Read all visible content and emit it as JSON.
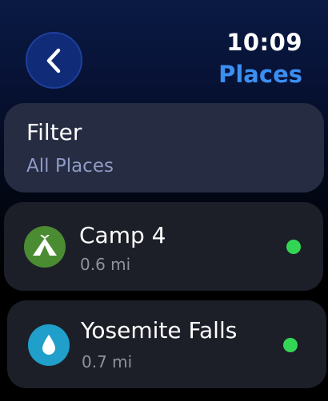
{
  "header": {
    "time": "10:09",
    "title": "Places",
    "back_icon": "chevron-left-icon"
  },
  "filter": {
    "label": "Filter",
    "value": "All Places"
  },
  "places": [
    {
      "name": "Camp 4",
      "distance": "0.6 mi",
      "icon": "campsite-tent-icon",
      "icon_color": "#4b8c33",
      "status_color": "#33d654"
    },
    {
      "name": "Yosemite Falls",
      "distance": "0.7 mi",
      "icon": "water-drop-icon",
      "icon_color": "#1f9fc9",
      "status_color": "#33d654"
    }
  ],
  "colors": {
    "accent": "#3b8ff1",
    "card": "#262c42",
    "row": "#1d1f28",
    "secondary_text": "#8f9bc6"
  }
}
